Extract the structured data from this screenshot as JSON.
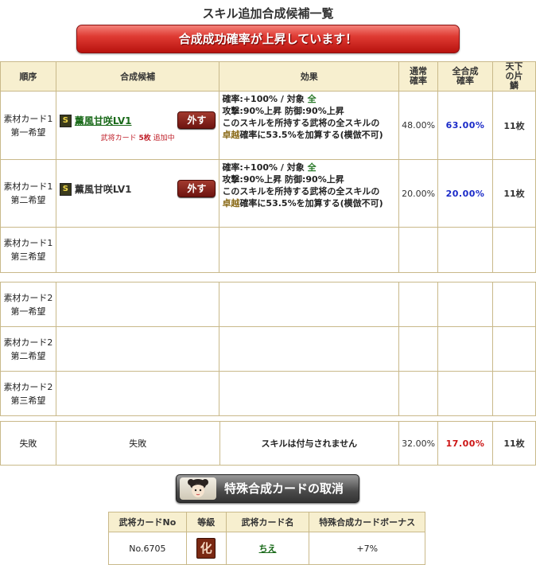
{
  "page": {
    "title": "スキル追加合成候補一覧",
    "banner": "合成成功確率が上昇しています！"
  },
  "table": {
    "headers": {
      "order": "順序",
      "candidate": "合成候補",
      "effect": "効果",
      "base_rate": "通常確率",
      "total_rate": "全合成確率",
      "pieces": "天下の片鱗"
    },
    "rows": [
      {
        "order_line1": "素材カード1",
        "order_line2": "第一希望",
        "skill_badge": "S",
        "skill_name": "薫風甘咲LV1",
        "remove_label": "外す",
        "note_prefix": "武将カード",
        "note_count": "5枚",
        "note_suffix": "追加中",
        "effect_1": "確率:+100% / 対象",
        "effect_target": "全",
        "effect_2": "攻撃:90%上昇 防御:90%上昇",
        "effect_3": "このスキルを所持する武将の全スキルの",
        "effect_kw": "卓越",
        "effect_4": "確率に53.5%を加算する(模倣不可)",
        "base_rate": "48.00%",
        "total_rate": "63.00%",
        "pieces": "11枚"
      },
      {
        "order_line1": "素材カード1",
        "order_line2": "第二希望",
        "skill_badge": "S",
        "skill_name": "薫風甘咲LV1",
        "remove_label": "外す",
        "effect_1": "確率:+100% / 対象",
        "effect_target": "全",
        "effect_2": "攻撃:90%上昇 防御:90%上昇",
        "effect_3": "このスキルを所持する武将の全スキルの",
        "effect_kw": "卓越",
        "effect_4": "確率に53.5%を加算する(模倣不可)",
        "base_rate": "20.00%",
        "total_rate": "20.00%",
        "pieces": "11枚"
      },
      {
        "order_line1": "素材カード1",
        "order_line2": "第三希望"
      },
      {
        "order_line1": "素材カード2",
        "order_line2": "第一希望"
      },
      {
        "order_line1": "素材カード2",
        "order_line2": "第二希望"
      },
      {
        "order_line1": "素材カード2",
        "order_line2": "第三希望"
      }
    ]
  },
  "fail": {
    "order": "失敗",
    "candidate": "失敗",
    "effect": "スキルは付与されません",
    "base_rate": "32.00%",
    "total_rate": "17.00%",
    "pieces": "11枚"
  },
  "cancel_button": "特殊合成カードの取消",
  "bonus_table": {
    "headers": {
      "card_no": "武将カードNo",
      "grade": "等級",
      "card_name": "武将カード名",
      "bonus": "特殊合成カードボーナス"
    },
    "row": {
      "card_no": "No.6705",
      "grade": "化",
      "card_name": "ちえ",
      "bonus": "+7%"
    }
  },
  "colors": {
    "header_bg": "#f7efcf",
    "border": "#c9b98a",
    "banner_red": "#df3b33",
    "rate_blue": "#1a2ac8",
    "rate_red": "#cc1414"
  }
}
